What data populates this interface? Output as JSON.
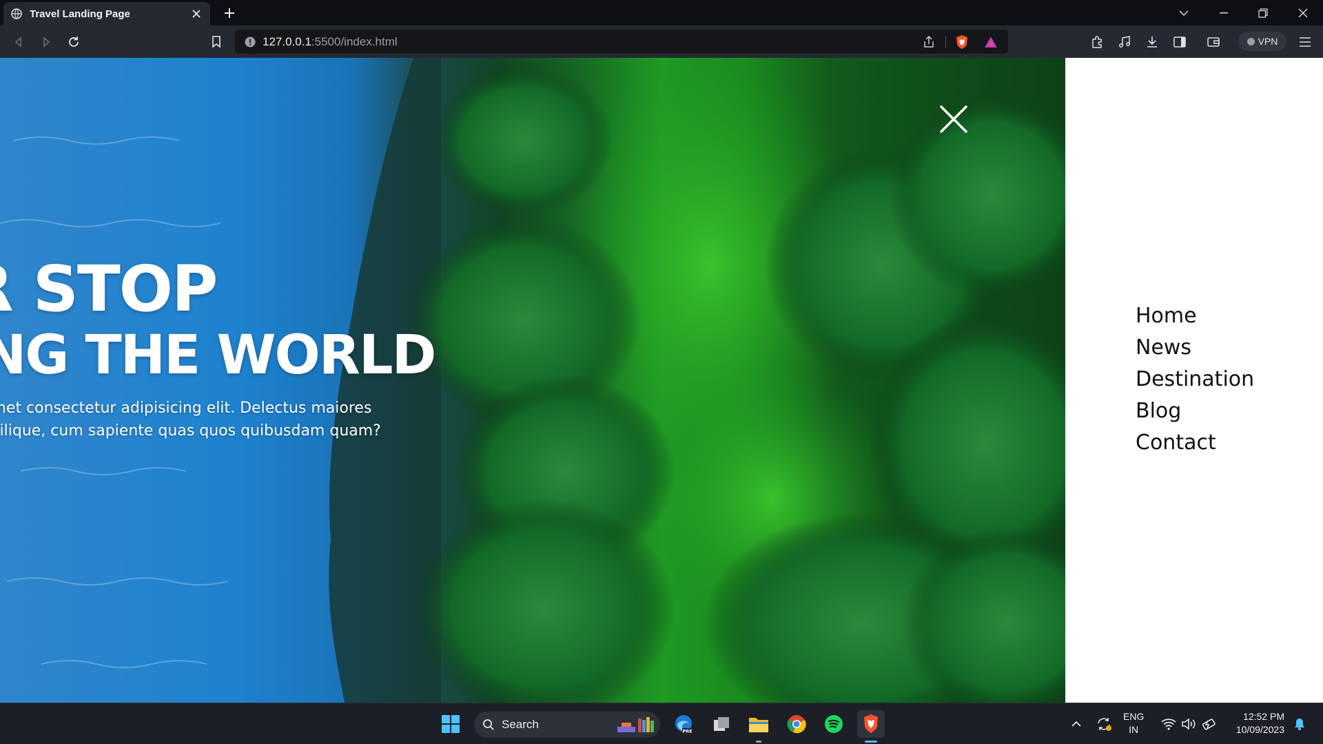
{
  "browser": {
    "tab_title": "Travel Landing Page",
    "url_host": "127.0.0.1",
    "url_path": ":5500/index.html",
    "vpn_label": "VPN"
  },
  "hero": {
    "line1": "ER STOP",
    "line2": "RING THE WORLD",
    "desc_line1": "amet consectetur adipisicing elit. Delectus maiores",
    "desc_line2": "imilique, cum sapiente quas quos quibusdam quam?"
  },
  "menu": {
    "items": [
      "Home",
      "News",
      "Destination",
      "Blog",
      "Contact"
    ]
  },
  "taskbar": {
    "search_label": "Search",
    "lang_line1": "ENG",
    "lang_line2": "IN",
    "time": "12:52 PM",
    "date": "10/09/2023"
  },
  "colors": {
    "menu_bg": "#ffffff",
    "accent_brave": "#fb542b",
    "taskbar_bg": "#1c1f26"
  }
}
